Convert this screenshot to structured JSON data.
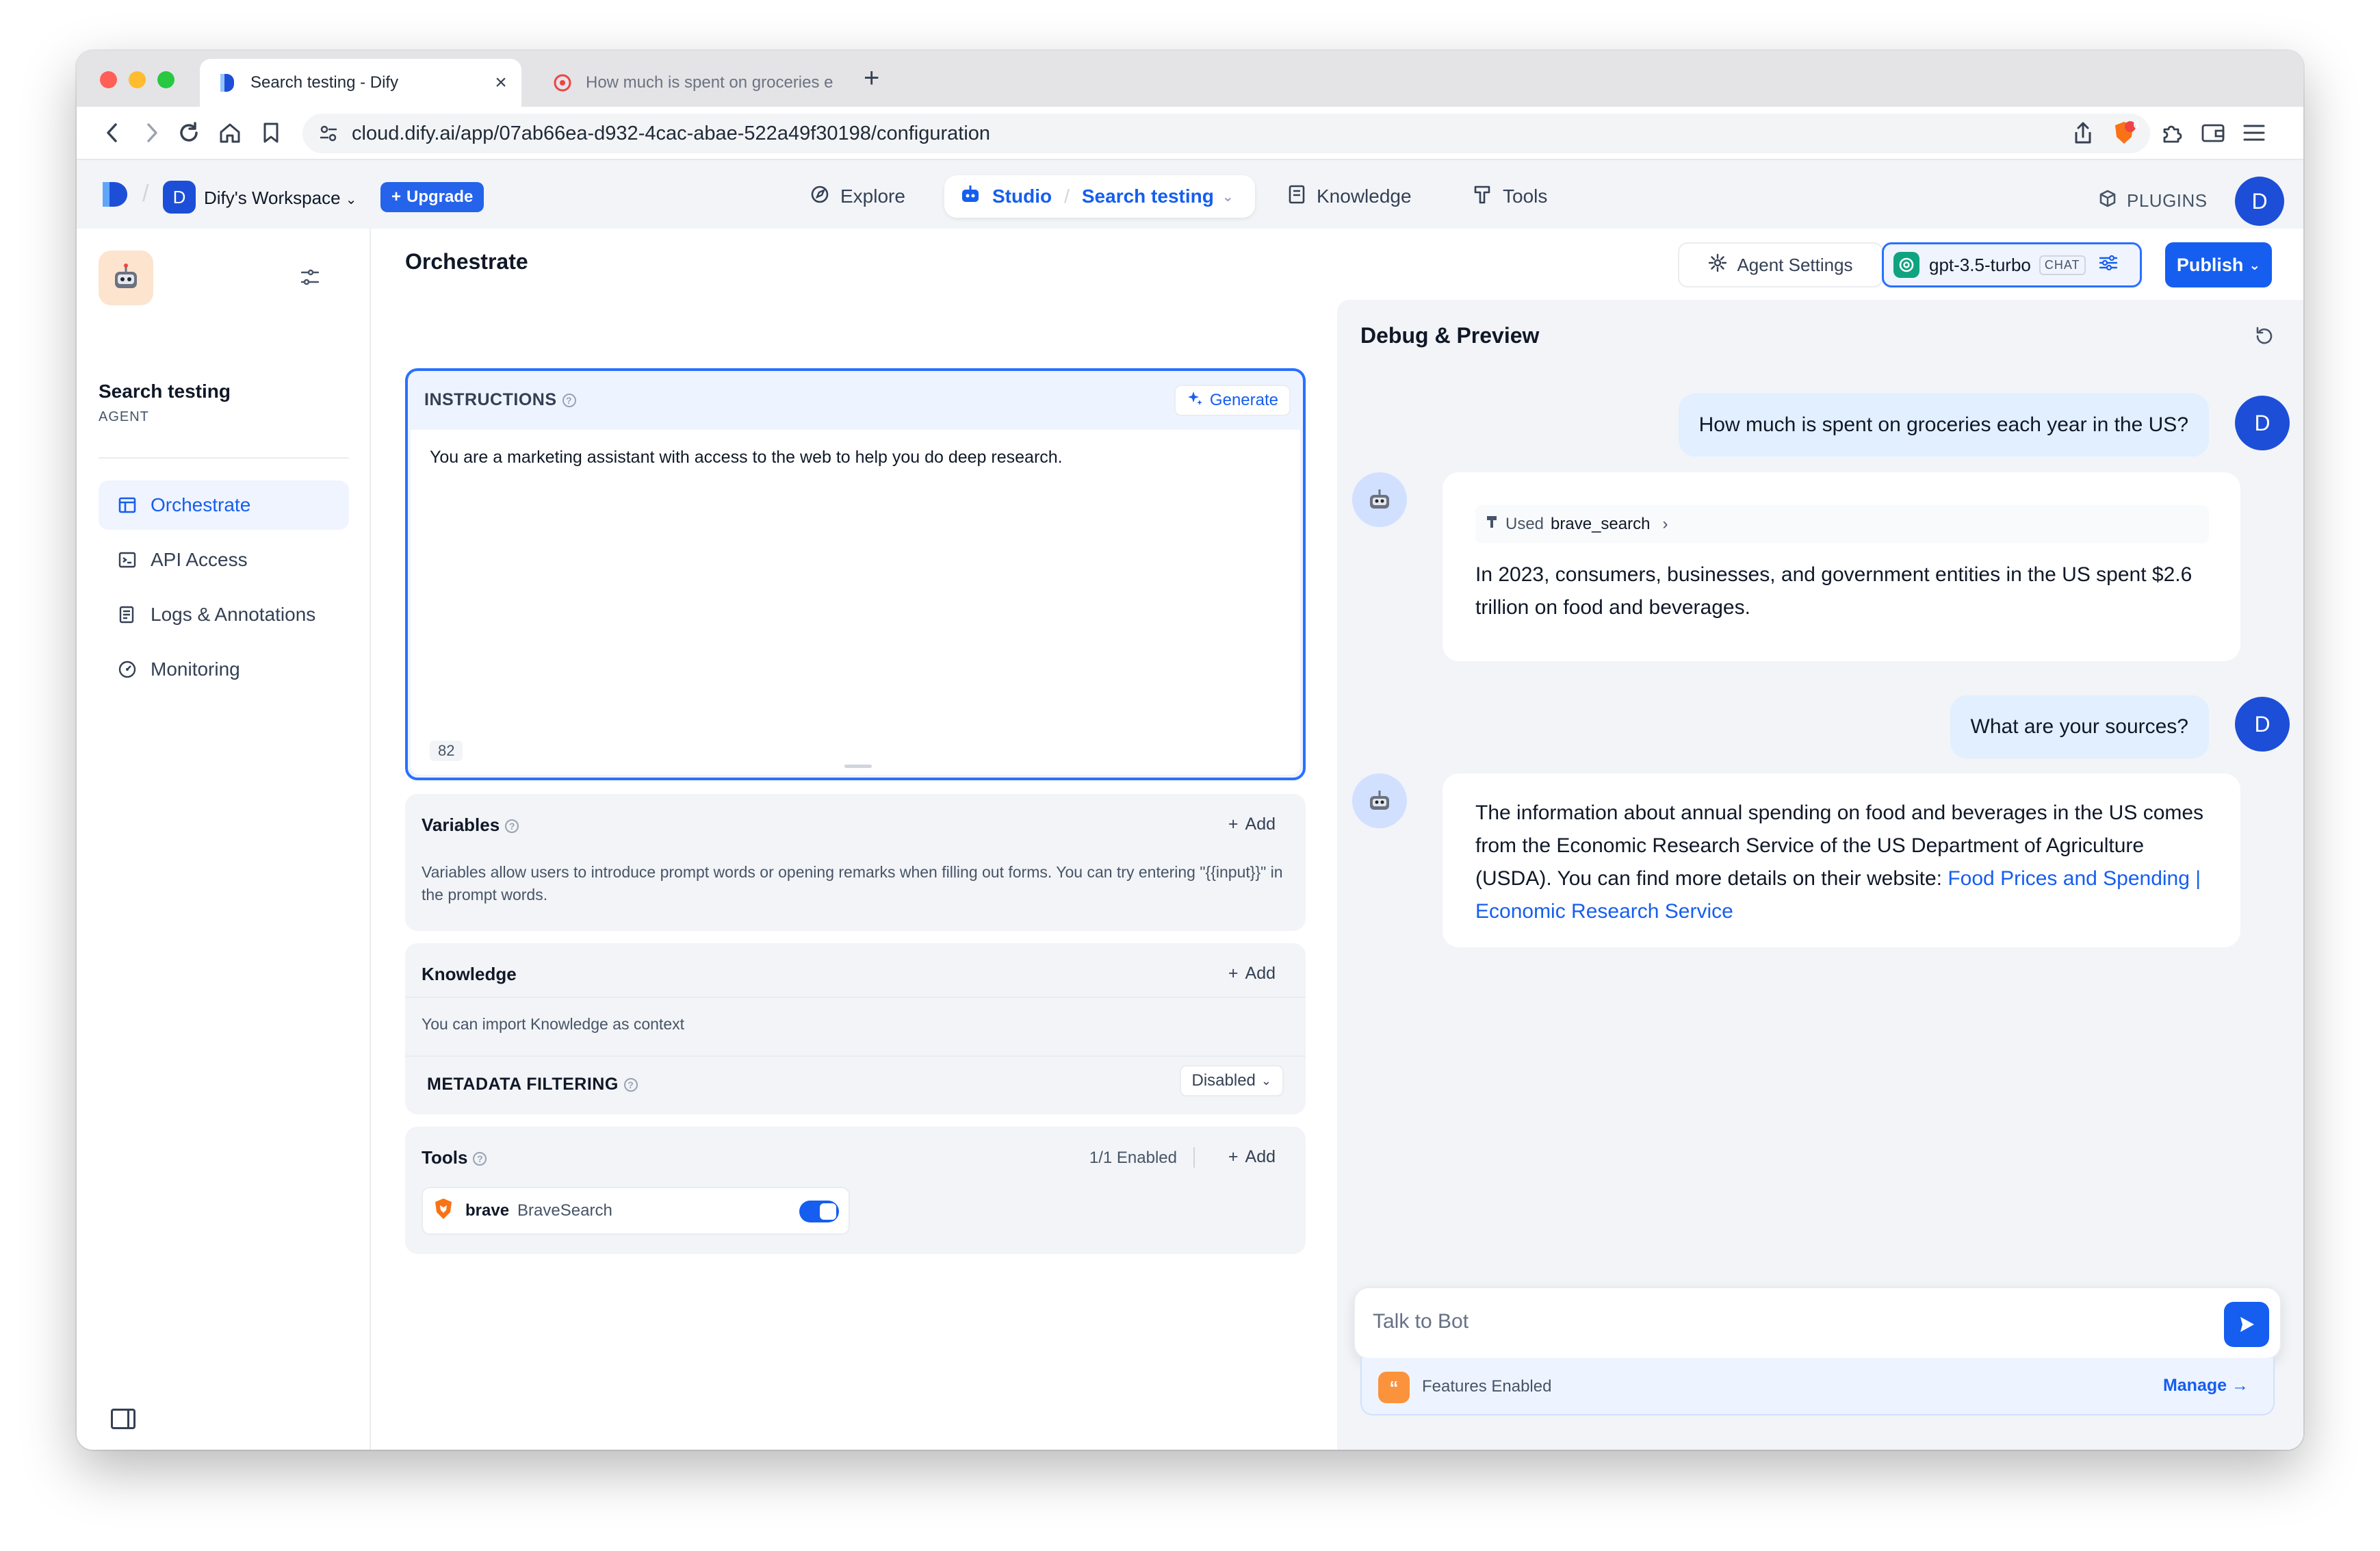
{
  "browser": {
    "tabs": [
      {
        "title": "Search testing - Dify",
        "close": "×"
      },
      {
        "title": "How much is spent on groceries e"
      }
    ],
    "new_tab": "+",
    "url": "cloud.dify.ai/app/07ab66ea-d932-4cac-abae-522a49f30198/configuration",
    "brave_badge": "6"
  },
  "header": {
    "workspace_initial": "D",
    "workspace_name": "Dify's Workspace",
    "upgrade_label": "Upgrade",
    "nav": {
      "explore": "Explore",
      "studio": "Studio",
      "app_name": "Search testing",
      "knowledge": "Knowledge",
      "tools": "Tools"
    },
    "plugins_label": "PLUGINS",
    "user_initial": "D"
  },
  "sidebar": {
    "app_title": "Search testing",
    "app_type": "AGENT",
    "items": [
      {
        "label": "Orchestrate",
        "icon": "layout-icon"
      },
      {
        "label": "API Access",
        "icon": "terminal-icon"
      },
      {
        "label": "Logs & Annotations",
        "icon": "file-list-icon"
      },
      {
        "label": "Monitoring",
        "icon": "dashboard-icon"
      }
    ]
  },
  "orchestrate": {
    "title": "Orchestrate",
    "instructions": {
      "label": "INSTRUCTIONS",
      "generate_label": "Generate",
      "text": "You are a marketing assistant with access to the web to help you do deep research.",
      "char_count": "82"
    },
    "variables": {
      "label": "Variables",
      "add_label": "Add",
      "description": "Variables allow users to introduce prompt words or opening remarks when filling out forms. You can try entering \"{{input}}\" in the prompt words."
    },
    "knowledge": {
      "label": "Knowledge",
      "add_label": "Add",
      "description": "You can import Knowledge as context",
      "metadata_label": "METADATA FILTERING",
      "metadata_value": "Disabled"
    },
    "tools": {
      "label": "Tools",
      "enabled_count": "1/1 Enabled",
      "add_label": "Add",
      "items": [
        {
          "provider": "brave",
          "name": "BraveSearch",
          "enabled": true
        }
      ]
    }
  },
  "toolbar": {
    "agent_settings": "Agent Settings",
    "model_name": "gpt-3.5-turbo",
    "model_badge": "CHAT",
    "publish_label": "Publish"
  },
  "debug": {
    "title": "Debug & Preview",
    "messages": [
      {
        "role": "user",
        "text": "How much is spent on groceries each year in the US?"
      },
      {
        "role": "bot",
        "tool_prefix": "Used",
        "tool_name": "brave_search",
        "text": "In 2023, consumers, businesses, and government entities in the US spent $2.6 trillion on food and beverages."
      },
      {
        "role": "user",
        "text": "What are your sources?"
      },
      {
        "role": "bot",
        "text": "The information about annual spending on food and beverages in the US comes from the Economic Research Service of the US Department of Agriculture (USDA). You can find more details on their website: ",
        "link_text": "Food Prices and Spending | Economic Research Service"
      }
    ],
    "input_placeholder": "Talk to Bot",
    "features_label": "Features Enabled",
    "manage_label": "Manage"
  }
}
